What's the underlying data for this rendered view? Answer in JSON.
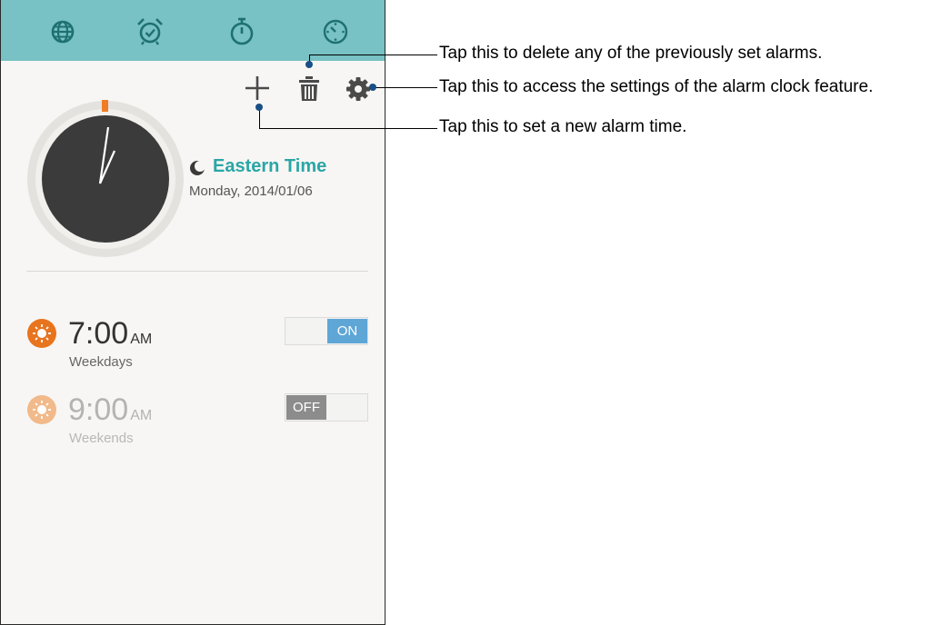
{
  "tabs": [
    {
      "icon": "world-clock-icon",
      "active": false
    },
    {
      "icon": "alarm-clock-icon",
      "active": true
    },
    {
      "icon": "stopwatch-icon",
      "active": false
    },
    {
      "icon": "timer-icon",
      "active": false
    }
  ],
  "actions": {
    "add_icon": "plus-icon",
    "delete_icon": "trash-icon",
    "settings_icon": "gear-icon"
  },
  "timezone": {
    "icon": "moon-icon",
    "name": "Eastern Time",
    "date": "Monday, 2014/01/06"
  },
  "alarms": [
    {
      "time": "7:00",
      "ampm": "AM",
      "repeat": "Weekdays",
      "state_label": "ON",
      "enabled": true,
      "icon": "sun-icon"
    },
    {
      "time": "9:00",
      "ampm": "AM",
      "repeat": "Weekends",
      "state_label": "OFF",
      "enabled": false,
      "icon": "sun-icon"
    }
  ],
  "callouts": {
    "delete": "Tap this to delete any of the previously set alarms.",
    "settings": "Tap this to access the settings of the alarm clock feature.",
    "add": "Tap this to set a new alarm time."
  },
  "colors": {
    "tab_bar": "#78c1c4",
    "tab_icon": "#1e7072",
    "accent_teal": "#2aa6a6",
    "toggle_on": "#5ea6d6",
    "toggle_off": "#8c8c8c",
    "alarm_icon_on": "#e8741e",
    "alarm_icon_off": "#f2b98a",
    "clock_face": "#3b3b3b",
    "callout_dot": "#184f86"
  }
}
